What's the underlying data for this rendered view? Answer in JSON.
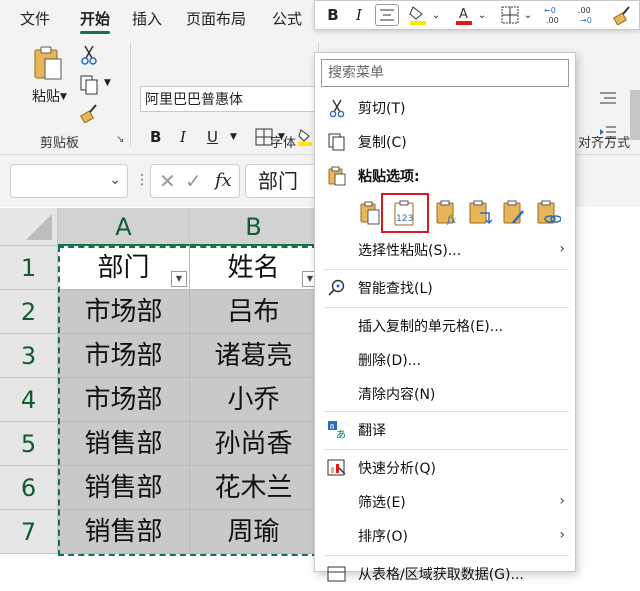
{
  "ribbon": {
    "tabs": [
      {
        "label": "文件"
      },
      {
        "label": "开始"
      },
      {
        "label": "插入"
      },
      {
        "label": "页面布局"
      },
      {
        "label": "公式"
      }
    ],
    "paste_label": "粘贴",
    "clipboard_group": "剪贴板",
    "font_name": "阿里巴巴普惠体",
    "font_group": "字体",
    "align_group": "对齐方式"
  },
  "formula_bar": {
    "name_box": "",
    "fx_label": "fx",
    "content": "部门"
  },
  "sheet": {
    "columns": [
      "A",
      "B"
    ],
    "rows": [
      "1",
      "2",
      "3",
      "4",
      "5",
      "6",
      "7"
    ],
    "cells": [
      [
        "部门",
        "姓名"
      ],
      [
        "市场部",
        "吕布"
      ],
      [
        "市场部",
        "诸葛亮"
      ],
      [
        "市场部",
        "小乔"
      ],
      [
        "销售部",
        "孙尚香"
      ],
      [
        "销售部",
        "花木兰"
      ],
      [
        "销售部",
        "周瑜"
      ]
    ]
  },
  "context_menu": {
    "search_placeholder": "搜索菜单",
    "items": {
      "cut": "剪切(T)",
      "copy": "复制(C)",
      "paste_options": "粘贴选项:",
      "paste_special": "选择性粘贴(S)...",
      "smart_lookup": "智能查找(L)",
      "insert_copied": "插入复制的单元格(E)...",
      "delete": "删除(D)...",
      "clear": "清除内容(N)",
      "translate": "翻译",
      "quick_analysis": "快速分析(Q)",
      "filter": "筛选(E)",
      "sort": "排序(O)",
      "partial": "从表格/区域获取数据(G)..."
    }
  },
  "colors": {
    "accent_green": "#117346",
    "highlight_red": "#d71920",
    "selection_gray": "#c9c9c9"
  }
}
